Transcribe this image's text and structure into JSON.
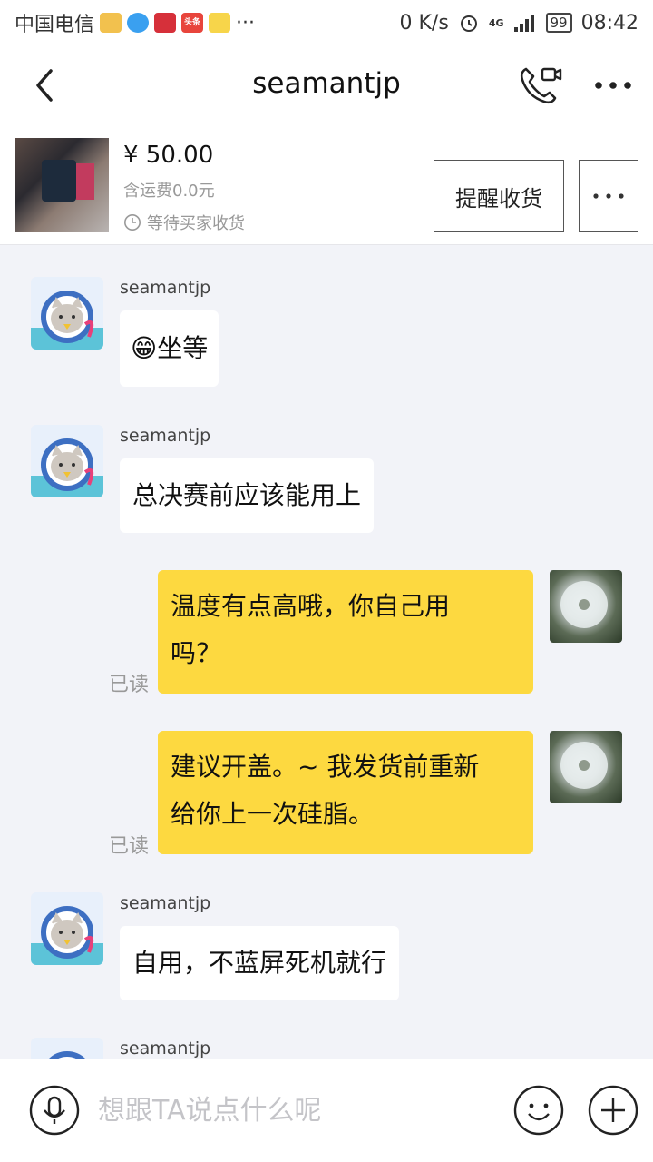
{
  "status_bar": {
    "carrier": "中国电信",
    "more": "···",
    "net_speed": "0 K/s",
    "network": "4G",
    "battery": "99",
    "time": "08:42",
    "app_icons": [
      {
        "name": "app-icon-1",
        "color": "#f2c14e"
      },
      {
        "name": "app-icon-2",
        "color": "#3aa0f0"
      },
      {
        "name": "app-icon-3",
        "color": "#d6303a"
      },
      {
        "name": "app-icon-4",
        "color": "#e8453c",
        "text": "头条"
      },
      {
        "name": "app-icon-5",
        "color": "#f7d54a"
      }
    ]
  },
  "header": {
    "title": "seamantjp"
  },
  "order": {
    "price": "¥ 50.00",
    "shipping": "含运费0.0元",
    "status": "等待买家收货",
    "remind_label": "提醒收货"
  },
  "messages": [
    {
      "side": "in",
      "sender": "seamantjp",
      "text": "坐等",
      "emoji": "😁"
    },
    {
      "side": "in",
      "sender": "seamantjp",
      "text": "总决赛前应该能用上"
    },
    {
      "side": "out",
      "line1": "温度有点高哦，你自己用",
      "line2": "吗？",
      "read": "已读"
    },
    {
      "side": "out",
      "line1": "建议开盖。~ 我发货前重新",
      "line2": "给你上一次硅脂。",
      "read": "已读"
    },
    {
      "side": "in",
      "sender": "seamantjp",
      "text": "自用，不蓝屏死机就行"
    },
    {
      "side": "in",
      "sender": "seamantjp"
    }
  ],
  "input": {
    "placeholder": "想跟TA说点什么呢"
  },
  "colors": {
    "accent_bubble": "#fdd940",
    "page_bg": "#f2f3f8"
  }
}
